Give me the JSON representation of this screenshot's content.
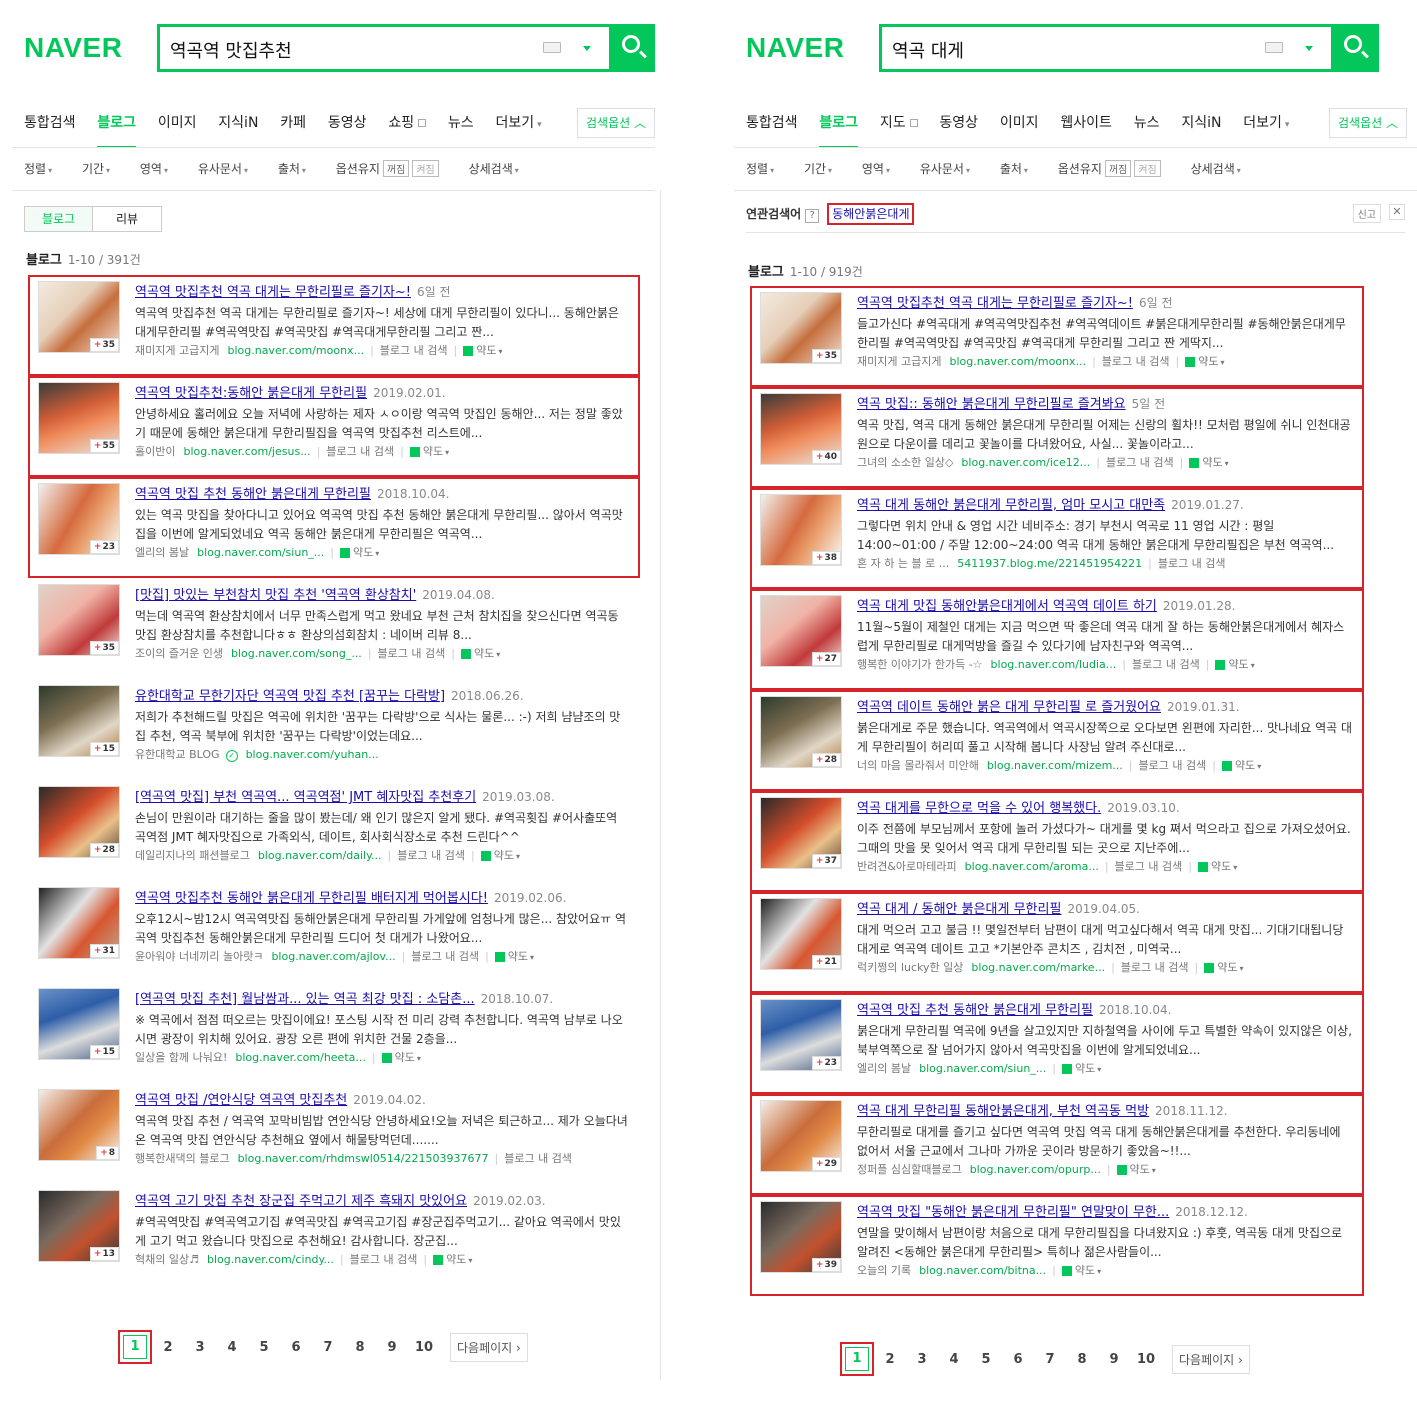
{
  "brand": {
    "logo": "NAVER",
    "color": "#03c75a",
    "highlight": "#d9232a"
  },
  "left": {
    "query": "역곡역 맛집추천",
    "tabs": [
      {
        "label": "통합검색"
      },
      {
        "label": "블로그"
      },
      {
        "label": "이미지"
      },
      {
        "label": "지식iN"
      },
      {
        "label": "카페"
      },
      {
        "label": "동영상"
      },
      {
        "label": "쇼핑"
      },
      {
        "label": "뉴스"
      },
      {
        "label": "더보기"
      }
    ],
    "options_label": "검색옵션",
    "filters": [
      "정렬",
      "기간",
      "영역",
      "유사문서",
      "출처"
    ],
    "option_keep": "옵션유지",
    "toggle_off": "꺼짐",
    "toggle_on": "켜짐",
    "advanced": "상세검색",
    "segments": [
      "블로그",
      "리뷰"
    ],
    "section": "블로그",
    "count": "1-10 / 391건",
    "results": [
      {
        "title": "역곡역 맛집추천 역곡 대게는 무한리필로 즐기자~!",
        "date": "6일 전",
        "desc": "역곡역 맛집추천 역곡 대게는 무한리필로 즐기자~! 세상에 대게 무한리필이 있다니... 동해안붉은대게무한리필 #역곡역맛집 #역곡맛집 #역곡대게무한리필 그리고 짠...",
        "author": "재미지게 고급지게",
        "url": "blog.naver.com/moonx...",
        "inblog": "블로그 내 검색",
        "map": "약도",
        "count": "35"
      },
      {
        "title": "역곡역 맛집추천:동해안 붉은대게 무한리필",
        "date": "2019.02.01.",
        "desc": "안녕하세요 홀러에요 오늘 저녁에 사랑하는 제자 ㅅㅇ이랑 역곡역 맛집인 동해안... 저는 정말 좋았기 때문에 동해안 붉은대게 무한리필집을 역곡역 맛집추천 리스트에...",
        "author": "홀이반이",
        "url": "blog.naver.com/jesus...",
        "inblog": "블로그 내 검색",
        "map": "약도",
        "count": "55"
      },
      {
        "title": "역곡역 맛집 추천 동해안 붉은대게 무한리필",
        "date": "2018.10.04.",
        "desc": "있는 역곡 맛집을 찾아다니고 있어요 역곡역 맛집 추천 동해안 붉은대게 무한리필... 않아서 역곡맛집을 이번에 알게되었네요 역곡 동해안 붉은대게 무한리필은 역곡역...",
        "author": "엘리의 봄날",
        "url": "blog.naver.com/siun_...",
        "inblog": "",
        "map": "약도",
        "count": "23"
      },
      {
        "title": "[맛집] 맛있는 부천참치 맛집 추천 '역곡역 환상참치'",
        "date": "2019.04.08.",
        "desc": "먹는데 역곡역 환상참치에서 너무 만족스럽게 먹고 왔네요 부천 근처 참치집을 찾으신다면 역곡동맛집 환상참치를 추천합니다ㅎㅎ 환상의섬회참치 : 네이버 리뷰 8...",
        "author": "조이의 즐거운 인생",
        "url": "blog.naver.com/song_...",
        "inblog": "블로그 내 검색",
        "map": "약도",
        "count": "35"
      },
      {
        "title": "유한대학교 무한기자단 역곡역 맛집 추천 [꿈꾸는 다락방]",
        "date": "2018.06.26.",
        "desc": "저희가 추천해드릴 맛집은 역곡에 위치한 '꿈꾸는 다락방'으로 식사는 물론... :-) 저희 냠냠조의 맛집 추천, 역곡 북부에 위치한 '꿈꾸는 다락방'이었는데요...",
        "author": "유한대학교 BLOG",
        "url": "blog.naver.com/yuhan...",
        "inblog": "",
        "map": "",
        "count": "15",
        "verified": "✓"
      },
      {
        "title": "[역곡역 맛집] 부천 역곡역... 역곡역점' JMT 혜자맛집 추천후기",
        "date": "2019.03.08.",
        "desc": "손님이 만원이라 대기하는 줄을 많이 봤는데/ 왜 인기 많은지 알게 됐다. #역곡횟집 #어사출또역곡역점 JMT 혜자맛집으로 가족외식, 데이트, 회사회식장소로 추천 드린다^^",
        "author": "데일리지나의 패션블로그",
        "url": "blog.naver.com/daily...",
        "inblog": "블로그 내 검색",
        "map": "약도",
        "count": "28"
      },
      {
        "title": "역곡역 맛집추천 동해안 붉은대게 무한리필 배터지게 먹어봅시다!",
        "date": "2019.02.06.",
        "desc": "오후12시~밤12시 역곡역맛집 동해안붉은대게 무한리필 가게앞에 엄청나게 많은... 참았어요ㅠ 역곡역 맛집추천 동해안붉은대게 무한리필 드디어 첫 대게가 나왔어요...",
        "author": "윤아워야 너네끼리 놀아랏ㅋ",
        "url": "blog.naver.com/ajlov...",
        "inblog": "블로그 내 검색",
        "map": "약도",
        "count": "31"
      },
      {
        "title": "[역곡역 맛집 추천] 월남쌈과... 있는 역곡 최강 맛집 : 소담촌...",
        "date": "2018.10.07.",
        "desc": "※ 역곡에서 점점 떠오르는 맛집이에요! 포스팅 시작 전 미리 강력 추천합니다. 역곡역 남부로 나오시면 광장이 위치해 있어요. 광장 오른 편에 위치한 건물 2층을...",
        "author": "일상을 함께 나눠요!",
        "url": "blog.naver.com/heeta...",
        "inblog": "",
        "map": "약도",
        "count": "15"
      },
      {
        "title": "역곡역 맛집 /연안식당 역곡역 맛집추천",
        "date": "2019.04.02.",
        "desc": "역곡역 맛집 추천 / 역곡역 꼬막비빔밥 연안식당 안녕하세요!오늘 저녁은 퇴근하고... 제가 오늘다녀온 역곡역 맛집 연안식당 추천해요 옆에서 해물탕먹던데.......",
        "author": "행복한새댁의 블로그",
        "url": "blog.naver.com/rhdmswl0514/221503937677",
        "inblog": "블로그 내 검색",
        "map": "",
        "count": "8"
      },
      {
        "title": "역곡역 고기 맛집 추천 장군집 주먹고기 제주 흑돼지 맛있어요",
        "date": "2019.02.03.",
        "desc": "#역곡역맛집 #역곡역고기집 #역곡맛집 #역곡고기집 #장군집주먹고기... 같아요 역곡에서 맛있게 고기 먹고 왔습니다 맛집으로 추천해요! 감사합니다. 장군집...",
        "author": "혁채의 일상♬",
        "url": "blog.naver.com/cindy...",
        "inblog": "블로그 내 검색",
        "map": "약도",
        "count": "13"
      }
    ],
    "pages": [
      "1",
      "2",
      "3",
      "4",
      "5",
      "6",
      "7",
      "8",
      "9",
      "10"
    ],
    "next": "다음페이지"
  },
  "right": {
    "query": "역곡 대게",
    "tabs": [
      {
        "label": "통합검색"
      },
      {
        "label": "블로그"
      },
      {
        "label": "지도"
      },
      {
        "label": "동영상"
      },
      {
        "label": "이미지"
      },
      {
        "label": "웹사이트"
      },
      {
        "label": "뉴스"
      },
      {
        "label": "지식iN"
      },
      {
        "label": "더보기"
      }
    ],
    "options_label": "검색옵션",
    "filters": [
      "정렬",
      "기간",
      "영역",
      "유사문서",
      "출처"
    ],
    "option_keep": "옵션유지",
    "toggle_off": "꺼짐",
    "toggle_on": "켜짐",
    "advanced": "상세검색",
    "related_label": "연관검색어",
    "related_q": "?",
    "related_kw": "동해안붉은대게",
    "report": "신고",
    "close": "✕",
    "section": "블로그",
    "count": "1-10 / 919건",
    "results": [
      {
        "title": "역곡역 맛집추천 역곡 대게는 무한리필로 즐기자~!",
        "date": "6일 전",
        "desc": "들고가신다 #역곡대게 #역곡역맛집추천 #역곡역데이트 #붉은대게무한리필 #동해안붉은대게무한리필 #역곡역맛집 #역곡맛집 #역곡대게 무한리필 그리고 짠 게딱지...",
        "author": "재미지게 고급지게",
        "url": "blog.naver.com/moonx...",
        "inblog": "블로그 내 검색",
        "map": "약도",
        "count": "35"
      },
      {
        "title": "역곡 맛집:: 동해안 붉은대게 무한리필로 즐겨봐요",
        "date": "5일 전",
        "desc": "역곡 맛집, 역곡 대게 동해안 붉은대게 무한리필 어제는 신랑의 휠차!! 모처럼 평일에 쉬니 인천대공원으로 다운이를 데리고 꽃놀이를 다녀왔어요, 사실... 꽃놀이라고...",
        "author": "그녀의 소소한 일상◇",
        "url": "blog.naver.com/ice12...",
        "inblog": "블로그 내 검색",
        "map": "약도",
        "count": "40"
      },
      {
        "title": "역곡 대게 동해안 붉은대게 무한리필, 엄마 모시고 대만족",
        "date": "2019.01.27.",
        "desc": "그렇다면 위치 안내 & 영업 시간 네비주소: 경기 부천시 역곡로 11 영업 시간 : 평일 14:00~01:00 / 주말 12:00~24:00 역곡 대게 동해안 붉은대게 무한리필집은 부천 역곡역...",
        "author": "혼 자 하 는 블 로 ...",
        "url": "5411937.blog.me/221451954221",
        "inblog": "블로그 내 검색",
        "map": "",
        "count": "38"
      },
      {
        "title": "역곡 대게 맛집 동해안붉은대게에서 역곡역 데이트 하기",
        "date": "2019.01.28.",
        "desc": "11월~5월이 제철인 대게는 지금 먹으면 딱 좋은데 역곡 대게 잘 하는 동해안붉은대게에서 혜자스럽게 무한리필로 대게먹방을 즐길 수 있다기에 남자친구와 역곡역...",
        "author": "행복한 이야기가 한가득 -☆",
        "url": "blog.naver.com/ludia...",
        "inblog": "블로그 내 검색",
        "map": "약도",
        "count": "27"
      },
      {
        "title": "역곡역 데이트 동해안 붉은 대게 무한리필 로 즐거웠어요",
        "date": "2019.01.31.",
        "desc": "붉은대게로 주문 했습니다. 역곡역에서 역곡시장쪽으로 오다보면 왼편에 자리한... 맛나네요 역곡 대게 무한리필이 허리띠 풀고 시작해 봅니다 사장님 알려 주신대로...",
        "author": "너의 마음 몰라줘서 미안해",
        "url": "blog.naver.com/mizem...",
        "inblog": "블로그 내 검색",
        "map": "약도",
        "count": "28"
      },
      {
        "title": "역곡 대게를 무한으로 먹을 수 있어 행복했다.",
        "date": "2019.03.10.",
        "desc": "이주 전쯤에 부모님께서 포항에 놀러 가셨다가~ 대게를 몇 kg 쪄서 먹으라고 집으로 가져오셨어요. 그때의 맛을 못 잊어서 역곡 대게 무한리필 되는 곳으로 지난주에...",
        "author": "반려견&아로마테라피",
        "url": "blog.naver.com/aroma...",
        "inblog": "블로그 내 검색",
        "map": "약도",
        "count": "37"
      },
      {
        "title": "역곡 대게 / 동해안 붉은대게 무한리필",
        "date": "2019.04.05.",
        "desc": "대게 먹으러 고고 불금 !! 몇일전부터 남편이 대게 먹고싶다해서 역곡 대게 맛집... 기대기대됩니당 대게로 역곡역 데이트 고고 *기본안주 콘치즈 , 김치전 , 미역국...",
        "author": "럭키쩡의 lucky한 일상",
        "url": "blog.naver.com/marke...",
        "inblog": "블로그 내 검색",
        "map": "약도",
        "count": "21"
      },
      {
        "title": "역곡역 맛집 추천 동해안 붉은대게 무한리필",
        "date": "2018.10.04.",
        "desc": "붉은대게 무한리필 역곡에 9년을 살고있지만 지하철역을 사이에 두고 특별한 약속이 있지않은 이상, 북부역쪽으로 잘 넘어가지 않아서 역곡맛집을 이번에 알게되었네요...",
        "author": "엘리의 봄날",
        "url": "blog.naver.com/siun_...",
        "inblog": "",
        "map": "약도",
        "count": "23"
      },
      {
        "title": "역곡 대게 무한리필 동해안붉은대게, 부천 역곡동 먹방",
        "date": "2018.11.12.",
        "desc": "무한리필로 대게를 즐기고 싶다면 역곡역 맛집 역곡 대게 동해안붉은대게를 추천한다. 우리동네에 없어서 서울 근교에서 그나마 가까운 곳이라 방문하기 좋았음~!!...",
        "author": "정퍼플 심심할때블로그",
        "url": "blog.naver.com/opurp...",
        "inblog": "",
        "map": "약도",
        "count": "29"
      },
      {
        "title": "역곡역 맛집 \"동해안 붉은대게 무한리필\" 연말맞이 무한...",
        "date": "2018.12.12.",
        "desc": "연말을 맞이해서 남편이랑 처음으로 대게 무한리필집을 다녀왔지요 :) 후훗, 역곡동 대게 맛집으로 알려진 <동해안 붉은대게 무한리필> 특히나 젊은사람들이...",
        "author": "오늘의 기록",
        "url": "blog.naver.com/bitna...",
        "inblog": "",
        "map": "약도",
        "count": "39"
      }
    ],
    "pages": [
      "1",
      "2",
      "3",
      "4",
      "5",
      "6",
      "7",
      "8",
      "9",
      "10"
    ],
    "next": "다음페이지"
  }
}
